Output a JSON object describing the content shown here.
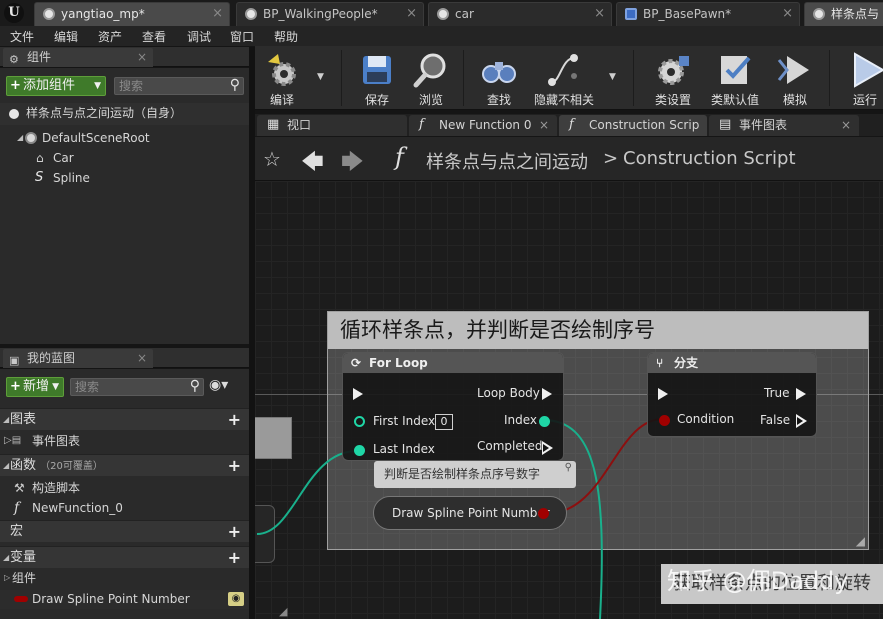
{
  "window": {
    "tabs": [
      {
        "label": "yangtiao_mp*"
      },
      {
        "label": "BP_WalkingPeople*"
      },
      {
        "label": "car"
      },
      {
        "label": "BP_BasePawn*"
      },
      {
        "label": "样条点与"
      }
    ]
  },
  "menubar": {
    "items": [
      "文件",
      "编辑",
      "资产",
      "查看",
      "调试",
      "窗口",
      "帮助"
    ]
  },
  "components_panel": {
    "title": "组件",
    "add_button": "添加组件",
    "search_placeholder": "搜索",
    "self_label": "样条点与点之间运动（自身）",
    "tree": [
      "DefaultSceneRoot",
      "Car",
      "Spline"
    ]
  },
  "blueprint_panel": {
    "title": "我的蓝图",
    "new_button": "新增",
    "search_placeholder": "搜索",
    "sections": {
      "graphs": "图表",
      "event_graph": "事件图表",
      "functions": "函数",
      "functions_sub": "（20可覆盖）",
      "construction_script": "构造脚本",
      "new_function": "NewFunction_0",
      "macros": "宏",
      "variables": "变量",
      "components": "组件",
      "var_item": "Draw Spline Point Number"
    }
  },
  "toolbar": {
    "compile": "编译",
    "save": "保存",
    "browse": "浏览",
    "find": "查找",
    "hide_unrelated": "隐藏不相关",
    "class_settings": "类设置",
    "class_defaults": "类默认值",
    "simulate": "模拟",
    "play": "运行"
  },
  "graph_tabs": [
    {
      "label": "视口"
    },
    {
      "label": "New Function 0"
    },
    {
      "label": "Construction Scrip"
    },
    {
      "label": "事件图表"
    }
  ],
  "breadcrumb": {
    "blueprint": "样条点与点之间运动",
    "separator": ">",
    "graph": "Construction Script"
  },
  "graph": {
    "comment_title": "循环样条点，并判断是否绘制序号",
    "for_loop": {
      "title": "For Loop",
      "loop_body": "Loop Body",
      "first_index": "First Index",
      "first_index_value": "0",
      "index": "Index",
      "last_index": "Last Index",
      "completed": "Completed"
    },
    "branch": {
      "title": "分支",
      "true": "True",
      "condition": "Condition",
      "false": "False"
    },
    "note": "判断是否绘制样条点序号数字",
    "var_node": "Draw Spline Point Number",
    "bottom_comment": "获取样条点的位置和旋转",
    "watermark": "知乎 @佣Daddy"
  },
  "colors": {
    "exec": "#f0f0f0",
    "int_pin": "#1fd6a6",
    "bool_pin": "#a00000",
    "wire_int": "#19b08c",
    "wire_bool": "#8c0f0f",
    "accent_green": "#3f7a2a"
  }
}
